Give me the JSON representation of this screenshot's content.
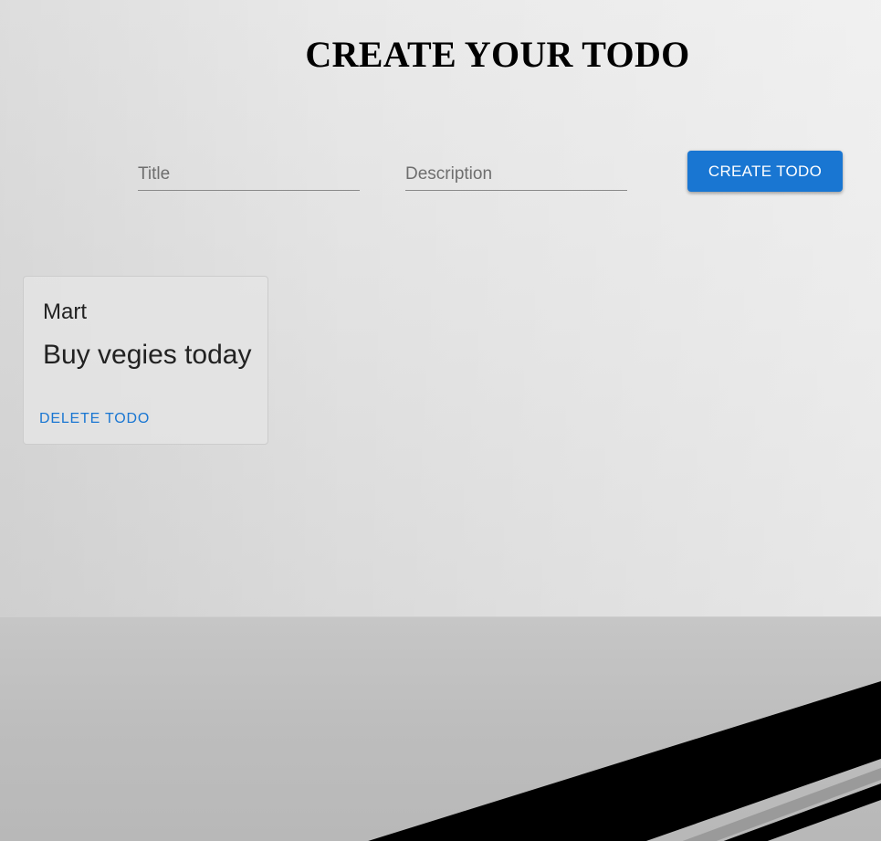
{
  "header": {
    "title": "CREATE YOUR TODO"
  },
  "form": {
    "title_placeholder": "Title",
    "title_value": "",
    "description_placeholder": "Description",
    "description_value": "",
    "create_label": "CREATE TODO"
  },
  "todos": [
    {
      "title": "Mart",
      "description": "Buy vegies today",
      "delete_label": "DELETE TODO"
    }
  ],
  "colors": {
    "accent": "#1976d2",
    "floor_stripe": "#000000"
  }
}
